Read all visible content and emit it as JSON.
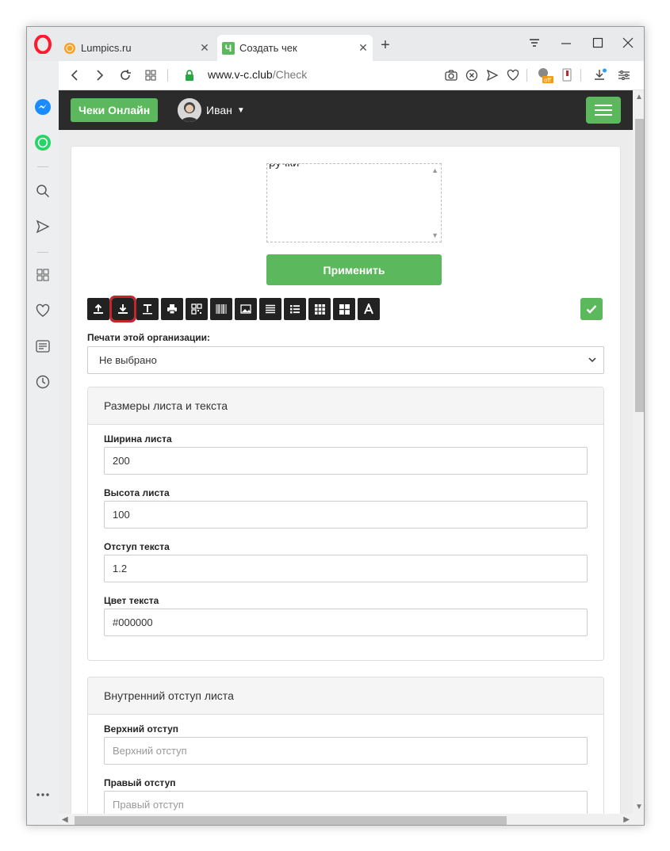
{
  "browser": {
    "tabs": [
      {
        "title": "Lumpics.ru",
        "close": "✕"
      },
      {
        "title": "Создать чек",
        "close": "✕",
        "favicon_letter": "Ч"
      }
    ],
    "new_tab": "+",
    "window_controls": {
      "minimize": "—",
      "maximize": "☐",
      "close": "✕"
    },
    "url": {
      "host": "www.v-c.club",
      "path": "/Check"
    }
  },
  "site": {
    "brand": "Чеки Онлайн",
    "user": "Иван"
  },
  "editor": {
    "textarea_text": "ручки",
    "apply_label": "Применить",
    "toolbar": [
      "upload-icon",
      "download-icon",
      "text-icon",
      "print-icon",
      "qr-icon",
      "barcode-icon",
      "image-icon",
      "align-icon",
      "list-icon",
      "grid3-icon",
      "grid2-icon",
      "font-icon"
    ],
    "stamp_label": "Печати этой организации:",
    "stamp_value": "Не выбрано"
  },
  "panel_size": {
    "title": "Размеры листа и текста",
    "fields": [
      {
        "label": "Ширина листа",
        "value": "200"
      },
      {
        "label": "Высота листа",
        "value": "100"
      },
      {
        "label": "Отступ текста",
        "value": "1.2"
      },
      {
        "label": "Цвет текста",
        "value": "#000000"
      }
    ]
  },
  "panel_padding": {
    "title": "Внутренний отступ листа",
    "fields": [
      {
        "label": "Верхний отступ",
        "placeholder": "Верхний отступ"
      },
      {
        "label": "Правый отступ",
        "placeholder": "Правый отступ"
      }
    ]
  },
  "colors": {
    "accent": "#5cb85c",
    "nav": "#2b2b2b",
    "highlight": "#c0282e"
  }
}
